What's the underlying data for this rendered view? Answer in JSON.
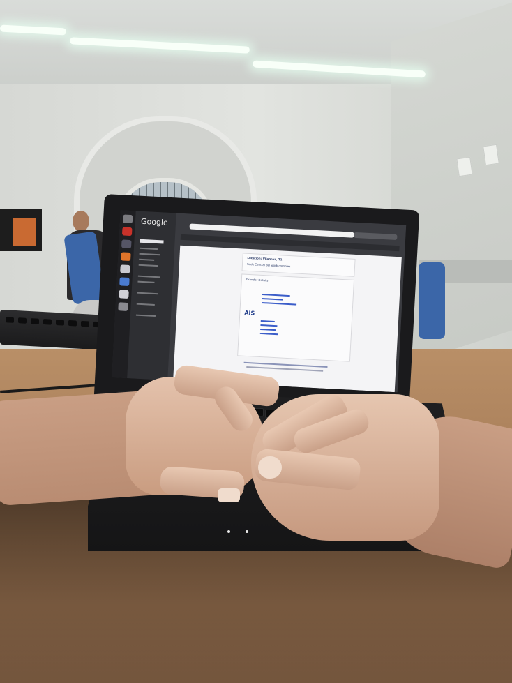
{
  "screen": {
    "browser_logo": "Google",
    "contact_card": {
      "heading": "Location: Vilanova, T1",
      "subheading": "Sede Central del work complex",
      "section_label": "Grander Details",
      "brand_mark": "AIS"
    }
  },
  "colors": {
    "desk": "#a47a56",
    "wall": "#d6d8d4",
    "laptop": "#1a1a1c",
    "chair": "#3b66a8",
    "skin": "#d6b098"
  }
}
